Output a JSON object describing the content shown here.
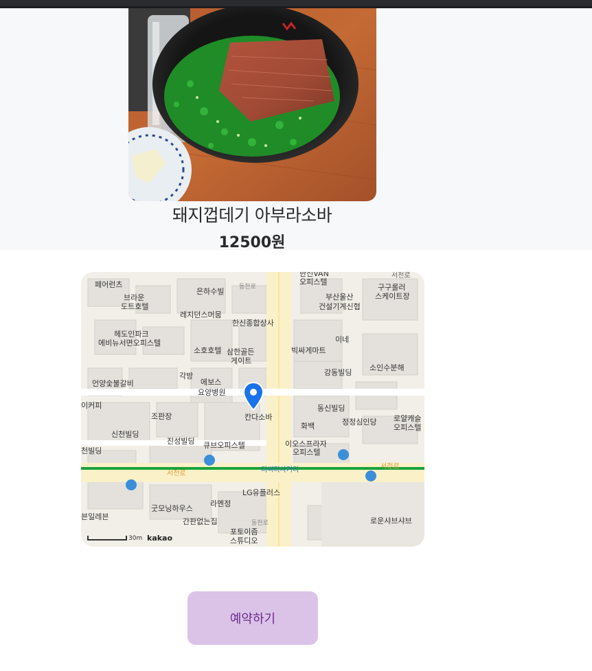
{
  "menu": {
    "name": "돼지껍데기 아부라소바",
    "price": "12500원"
  },
  "map": {
    "labels": {
      "perolants": "페어런츠",
      "hanshin_van": "한신VAN",
      "officetel": "오피스텔",
      "seocheon": "서천로",
      "guguroller": "구구롤러",
      "skatejang": "스케이트장",
      "brown": "브라운",
      "dotohotel": "도트호텔",
      "eunhasubil": "은하수빌",
      "busanulsan": "부산울산",
      "geonseol": "건설기계신협",
      "regidence": "레지던스머뭄",
      "hanshin_sangga": "한신종합상사",
      "ine": "이네",
      "hyedo": "헤도인파크",
      "ebinew": "에비뉴서면오피스텔",
      "sohohotel": "소호호텔",
      "samhan": "삼한골든",
      "gate": "게이트",
      "bikssamart": "빅싸게마트",
      "soinsu": "소인수분해",
      "gakbang": "각방",
      "eboss": "에보스",
      "yoyang": "요양병원",
      "gangdong": "강동빌딩",
      "eonyang": "언양숯불갈비",
      "dongshin": "동신빌딩",
      "ikeopi": "이커피",
      "jopanjang": "조판장",
      "kantada": "칸다소바",
      "jeongjeong": "정정심인당",
      "loyal1": "로얄캐슬",
      "loyal2": "오피스텔",
      "hwabaek": "화백",
      "sincheon": "신천빌딩",
      "jinseong": "진성빌딩",
      "cube": "큐브오피스텔",
      "io1": "이오스프라자",
      "io2": "오피스텔",
      "cheonbil": "천빌딩",
      "seojeonro": "서전로",
      "tcity": "티씨티사거리",
      "lg": "LG유플러스",
      "goodmorning": "굿모닝하우스",
      "ramen": "라멘정",
      "ganpan": "간판없는집",
      "seveneleven": "븐일레븐",
      "portoi1": "포토이즘",
      "portoi2": "스튜디오",
      "rowoon": "로운샤브샤브",
      "dongcheonro": "동천로",
      "scale": "30m",
      "kakao": "kakao"
    }
  },
  "actions": {
    "reserve_label": "예약하기"
  },
  "colors": {
    "hero_bg": "#f7f8fa",
    "button_bg": "#dbc3e8",
    "button_text": "#6a2c8c",
    "marker": "#1a73e8",
    "subway_line": "#1aa33b"
  }
}
